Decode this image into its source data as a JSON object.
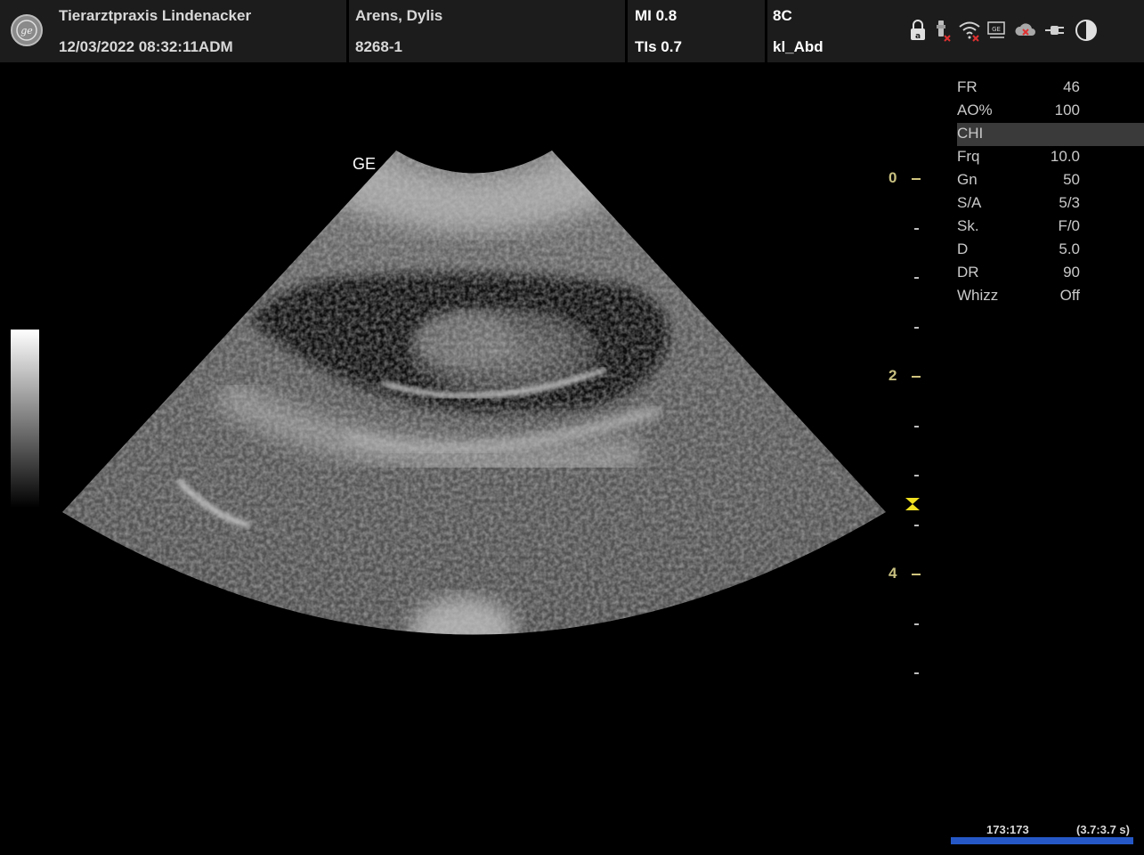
{
  "header": {
    "site_name": "Tierarztpraxis Lindenacker",
    "datetime": "12/03/2022 08:32:11ADM",
    "patient_name": "Arens, Dylis",
    "patient_id": "8268-1",
    "mi": "MI 0.8",
    "tis": "TIs 0.7",
    "probe": "8C",
    "preset": "kl_Abd",
    "status_icons": [
      "lock-icon",
      "probe-disconnected-icon",
      "wifi-disconnected-icon",
      "ge-network-icon",
      "cloud-disconnected-icon",
      "power-plug-icon",
      "brightness-icon"
    ]
  },
  "params": [
    {
      "key": "FR",
      "value": "46"
    },
    {
      "key": "AO%",
      "value": "100"
    },
    {
      "key": "CHI",
      "value": "",
      "highlight": true
    },
    {
      "key": "Frq",
      "value": "10.0"
    },
    {
      "key": "Gn",
      "value": "50"
    },
    {
      "key": "S/A",
      "value": "5/3"
    },
    {
      "key": "Sk.",
      "value": "F/0"
    },
    {
      "key": "D",
      "value": "5.0"
    },
    {
      "key": "DR",
      "value": "90"
    },
    {
      "key": "Whizz",
      "value": "Off"
    }
  ],
  "image": {
    "orientation_mark": "GE"
  },
  "depth_scale": {
    "labels": [
      "0",
      "2",
      "4"
    ],
    "unit_max": 5,
    "focus_depth": 3.3
  },
  "cine": {
    "frames": "173:173",
    "duration": "(3.7:3.7 s)",
    "progress": 1.0
  },
  "colors": {
    "header_bg": "#1c1c1c",
    "scale_label": "#c8c080",
    "focus_marker": "#f0e020",
    "cine_bar": "#2558c6",
    "param_highlight": "#3a3a3a"
  }
}
